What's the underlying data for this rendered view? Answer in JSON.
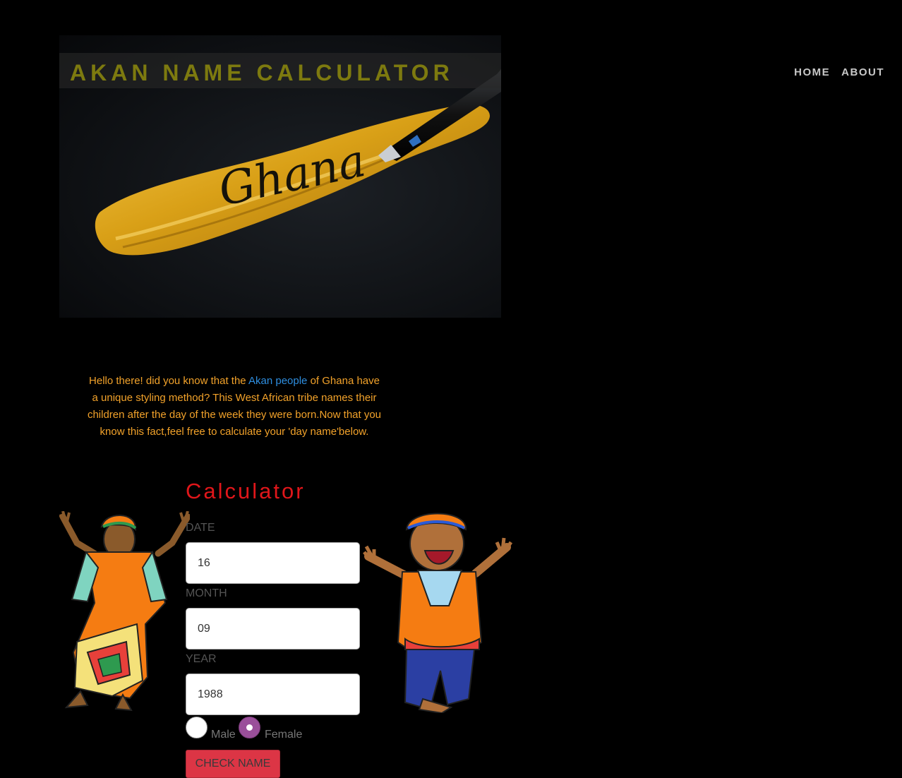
{
  "header": {
    "title": "AKAN NAME CALCULATOR",
    "nav": [
      {
        "label": "HOME"
      },
      {
        "label": "ABOUT"
      }
    ]
  },
  "hero": {
    "image_word": "Ghana"
  },
  "intro": {
    "before_link": "Hello there! did you know that the ",
    "link_text": "Akan people",
    "after_link": " of Ghana have a unique styling method? This West African tribe names their children after the day of the week they were born.Now that you know this fact,feel free to calculate your 'day name'below."
  },
  "calculator": {
    "title": "Calculator",
    "date_label": "DATE",
    "date_value": "16",
    "month_label": "MONTH",
    "month_value": "09",
    "year_label": "YEAR",
    "year_value": "1988",
    "gender_options": [
      {
        "label": "Male",
        "checked": false
      },
      {
        "label": "Female",
        "checked": true
      }
    ],
    "submit_label": "CHECK NAME"
  },
  "colors": {
    "title": "#7d7a0f",
    "intro_text": "#f2a22a",
    "link": "#2e8ee0",
    "calculator_title": "#e0161a",
    "button": "#dc3545",
    "radio_checked": "#9a4f9a"
  }
}
